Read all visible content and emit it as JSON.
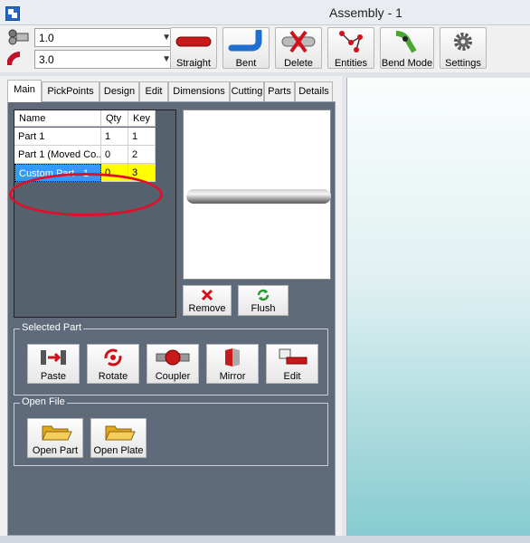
{
  "window": {
    "title": "Assembly - 1"
  },
  "toolbar": {
    "size_value": "1.0",
    "radius_value": "3.0",
    "buttons": [
      {
        "label": "Straight",
        "icon": "straight-tube-icon"
      },
      {
        "label": "Bent",
        "icon": "bent-tube-icon"
      },
      {
        "label": "Delete",
        "icon": "delete-icon"
      },
      {
        "label": "Entities",
        "icon": "entities-icon"
      },
      {
        "label": "Bend Mode",
        "icon": "bend-mode-icon"
      },
      {
        "label": "Settings",
        "icon": "gear-icon"
      }
    ]
  },
  "tabs": [
    "Main",
    "PickPoints",
    "Design",
    "Edit",
    "Dimensions",
    "Cutting",
    "Parts",
    "Details"
  ],
  "parts_table": {
    "headers": [
      "Name",
      "Qty",
      "Key"
    ],
    "rows": [
      {
        "name": "Part 1",
        "qty": "1",
        "key": "1"
      },
      {
        "name": "Part 1 (Moved Co...",
        "qty": "0",
        "key": "2"
      },
      {
        "name": "Custom Part - 1",
        "qty": "0",
        "key": "3"
      }
    ]
  },
  "preview_buttons": [
    {
      "label": "Remove",
      "icon": "remove-icon"
    },
    {
      "label": "Flush",
      "icon": "flush-icon"
    }
  ],
  "selected_part": {
    "legend": "Selected Part",
    "buttons": [
      {
        "label": "Paste",
        "icon": "paste-icon"
      },
      {
        "label": "Rotate",
        "icon": "rotate-icon"
      },
      {
        "label": "Coupler",
        "icon": "coupler-icon"
      },
      {
        "label": "Mirror",
        "icon": "mirror-icon"
      },
      {
        "label": "Edit",
        "icon": "edit-part-icon"
      }
    ]
  },
  "open_file": {
    "legend": "Open File",
    "buttons": [
      {
        "label": "Open Part",
        "icon": "folder-open-icon"
      },
      {
        "label": "Open Plate",
        "icon": "folder-open-icon"
      }
    ]
  },
  "colors": {
    "accent_red": "#e0102a",
    "selection_blue": "#3399ff",
    "highlight_yellow": "#ffff00",
    "panel_gray": "#5f6b7a"
  }
}
